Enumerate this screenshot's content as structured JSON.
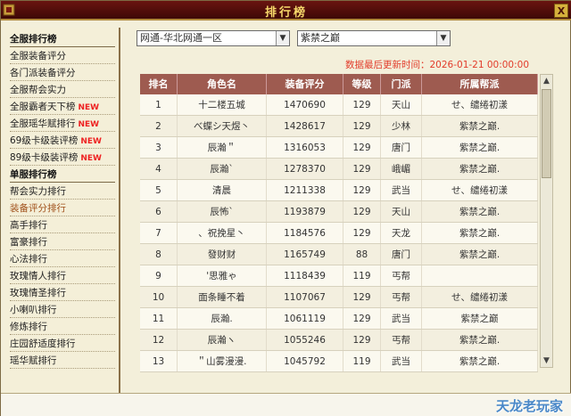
{
  "window": {
    "title": "排行榜",
    "close": "X"
  },
  "sidebar": {
    "items": [
      {
        "label": "全服排行榜",
        "type": "header",
        "new": ""
      },
      {
        "label": "全服装备评分",
        "type": "item",
        "new": ""
      },
      {
        "label": "各门派装备评分",
        "type": "item",
        "new": ""
      },
      {
        "label": "全服帮会实力",
        "type": "item",
        "new": ""
      },
      {
        "label": "全服霸者天下榜",
        "type": "item",
        "new": "NEW"
      },
      {
        "label": "全服瑶华赋排行",
        "type": "item",
        "new": "NEW"
      },
      {
        "label": "69级卡级装评榜",
        "type": "item",
        "new": "NEW"
      },
      {
        "label": "89级卡级装评榜",
        "type": "item",
        "new": "NEW"
      },
      {
        "label": "单服排行榜",
        "type": "header",
        "new": ""
      },
      {
        "label": "帮会实力排行",
        "type": "item",
        "new": ""
      },
      {
        "label": "装备评分排行",
        "type": "active",
        "new": ""
      },
      {
        "label": "高手排行",
        "type": "item",
        "new": ""
      },
      {
        "label": "富豪排行",
        "type": "item",
        "new": ""
      },
      {
        "label": "心法排行",
        "type": "item",
        "new": ""
      },
      {
        "label": "玫瑰情人排行",
        "type": "item",
        "new": ""
      },
      {
        "label": "玫瑰情圣排行",
        "type": "item",
        "new": ""
      },
      {
        "label": "小喇叭排行",
        "type": "item",
        "new": ""
      },
      {
        "label": "修炼排行",
        "type": "item",
        "new": ""
      },
      {
        "label": "庄园舒适度排行",
        "type": "item",
        "new": ""
      },
      {
        "label": "瑶华赋排行",
        "type": "item",
        "new": ""
      }
    ]
  },
  "filters": {
    "server": "网通-华北网通一区",
    "guild": "紫禁之巅"
  },
  "update_text": "数据最后更新时间：2026-01-21 00:00:00",
  "table": {
    "headers": [
      "排名",
      "角色名",
      "装备评分",
      "等级",
      "门派",
      "所属帮派"
    ],
    "rows": [
      [
        "1",
        "十二楼五城",
        "1470690",
        "129",
        "天山",
        "せ、缱绻初漾"
      ],
      [
        "2",
        "べ蝶シ天煜丶",
        "1428617",
        "129",
        "少林",
        "紫禁之巅."
      ],
      [
        "3",
        "辰瀚＂",
        "1316053",
        "129",
        "唐门",
        "紫禁之巅."
      ],
      [
        "4",
        "辰瀚`",
        "1278370",
        "129",
        "峨嵋",
        "紫禁之巅."
      ],
      [
        "5",
        "清晨",
        "1211338",
        "129",
        "武当",
        "せ、缱绻初漾"
      ],
      [
        "6",
        "辰怖`",
        "1193879",
        "129",
        "天山",
        "紫禁之巅."
      ],
      [
        "7",
        "、祝挽星丶",
        "1184576",
        "129",
        "天龙",
        "紫禁之巅."
      ],
      [
        "8",
        "發财财",
        "1165749",
        "88",
        "唐门",
        "紫禁之巅."
      ],
      [
        "9",
        "'思雅ゃ",
        "1118439",
        "119",
        "丐帮",
        ""
      ],
      [
        "10",
        "面条睡不着",
        "1107067",
        "129",
        "丐帮",
        "せ、缱绻初漾"
      ],
      [
        "11",
        "辰瀚.",
        "1061119",
        "129",
        "武当",
        "紫禁之巅"
      ],
      [
        "12",
        "辰瀚ヽ",
        "1055246",
        "129",
        "丐帮",
        "紫禁之巅."
      ],
      [
        "13",
        "＂山雾漫漫.",
        "1045792",
        "119",
        "武当",
        "紫禁之巅."
      ]
    ]
  },
  "watermark": "天龙老玩家",
  "colors": {
    "title_bg": "#5a100c",
    "header_bg": "#9e5b50",
    "new_badge": "#e22222",
    "update_text": "#e23b2a"
  }
}
